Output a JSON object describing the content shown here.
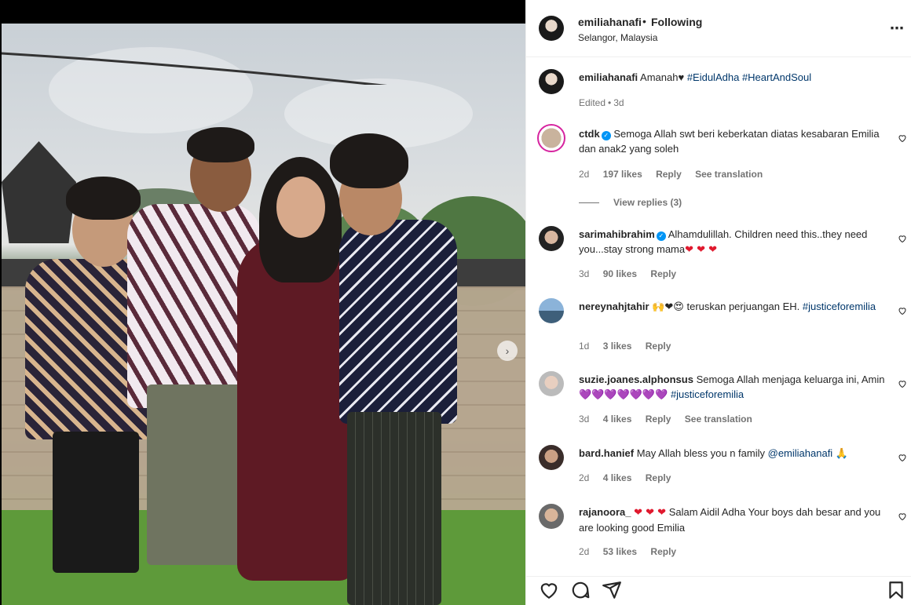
{
  "post": {
    "username": "emiliahanafi",
    "follow_status": "Following",
    "separator": "•",
    "location": "Selangor, Malaysia",
    "caption_user": "emiliahanafi",
    "caption_text": "Amanah",
    "caption_heart": "♥",
    "caption_tags": [
      "#EidulAdha",
      "#HeartAndSoul"
    ],
    "edited": "Edited",
    "edited_time": "3d"
  },
  "comments": [
    {
      "user": "ctdk",
      "verified": true,
      "text": "Semoga Allah swt beri keberkatan diatas kesabaran Emilia dan anak2 yang soleh",
      "time": "2d",
      "likes": "197 likes",
      "reply": "Reply",
      "translate": "See translation",
      "view_replies": "View replies (3)"
    },
    {
      "user": "sarimahibrahim",
      "verified": true,
      "text": "Alhamdulillah. Children need this..they need you...stay strong mama",
      "emoji": "❤ ❤ ❤",
      "time": "3d",
      "likes": "90 likes",
      "reply": "Reply"
    },
    {
      "user": "nereynahjtahir",
      "emoji": "🙌❤😍",
      "text": "teruskan perjuangan EH.",
      "tag": "#justiceforemilia",
      "time": "1d",
      "likes": "3 likes",
      "reply": "Reply"
    },
    {
      "user": "suzie.joanes.alphonsus",
      "text": "Semoga Allah menjaga keluarga ini, Amin",
      "emoji": "💜💜💜💜💜💜💜",
      "tag": "#justiceforemilia",
      "time": "3d",
      "likes": "4 likes",
      "reply": "Reply",
      "translate": "See translation"
    },
    {
      "user": "bard.hanief",
      "text": "May Allah bless you n family",
      "tag": "@emiliahanafi",
      "emoji": "🙏",
      "time": "2d",
      "likes": "4 likes",
      "reply": "Reply"
    },
    {
      "user": "rajanoora_",
      "emoji": "❤ ❤ ❤",
      "text": "Salam Aidil Adha Your boys dah besar and you are looking good Emilia",
      "time": "2d",
      "likes": "53 likes",
      "reply": "Reply"
    }
  ],
  "icons": {
    "more": "more-options-icon",
    "like": "heart-icon",
    "comment": "comment-icon",
    "share": "share-icon",
    "save": "bookmark-icon",
    "next": "chevron-right-icon",
    "comment_like": "heart-outline-icon"
  },
  "colors": {
    "link": "#00376b",
    "muted": "#737373",
    "verified": "#0095f6"
  }
}
